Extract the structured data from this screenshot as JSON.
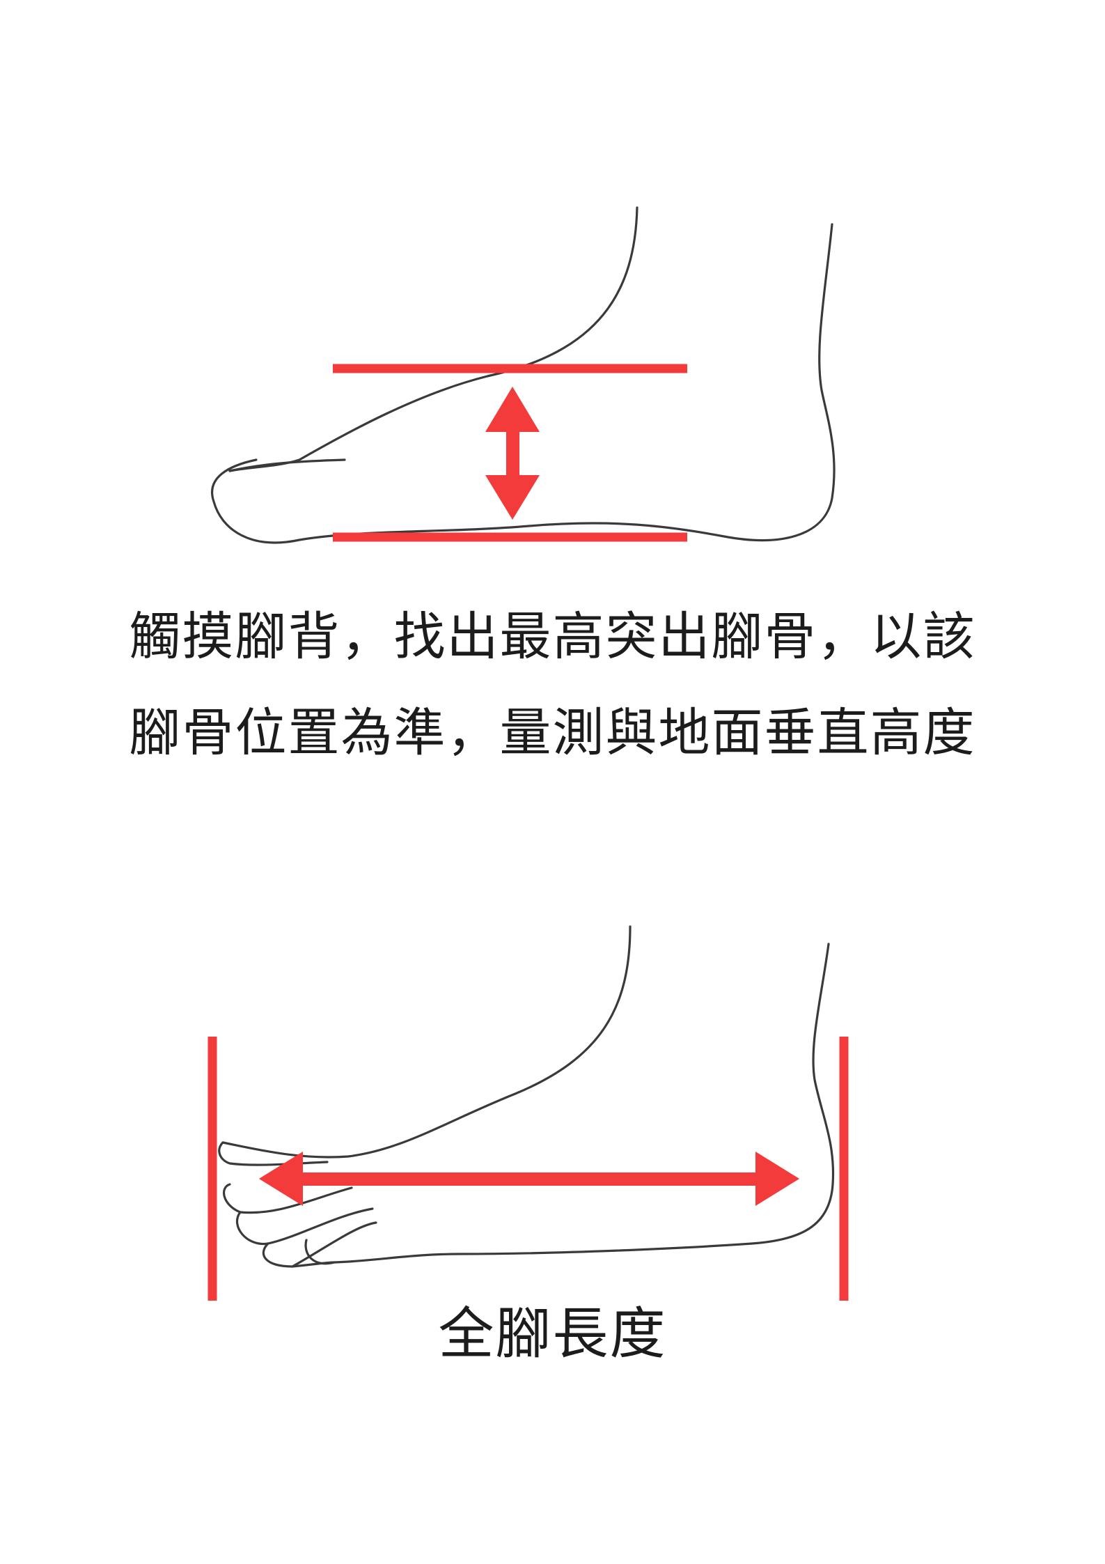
{
  "instep_height": {
    "caption_line_1": "觸摸腳背，找出最高突出腳骨，以該",
    "caption_line_2": "腳骨位置為準，量測與地面垂直高度"
  },
  "foot_length": {
    "caption": "全腳長度"
  },
  "colors": {
    "marker": "#f43b3b",
    "outline": "#3a3a3a",
    "text": "#1c1c1c"
  }
}
